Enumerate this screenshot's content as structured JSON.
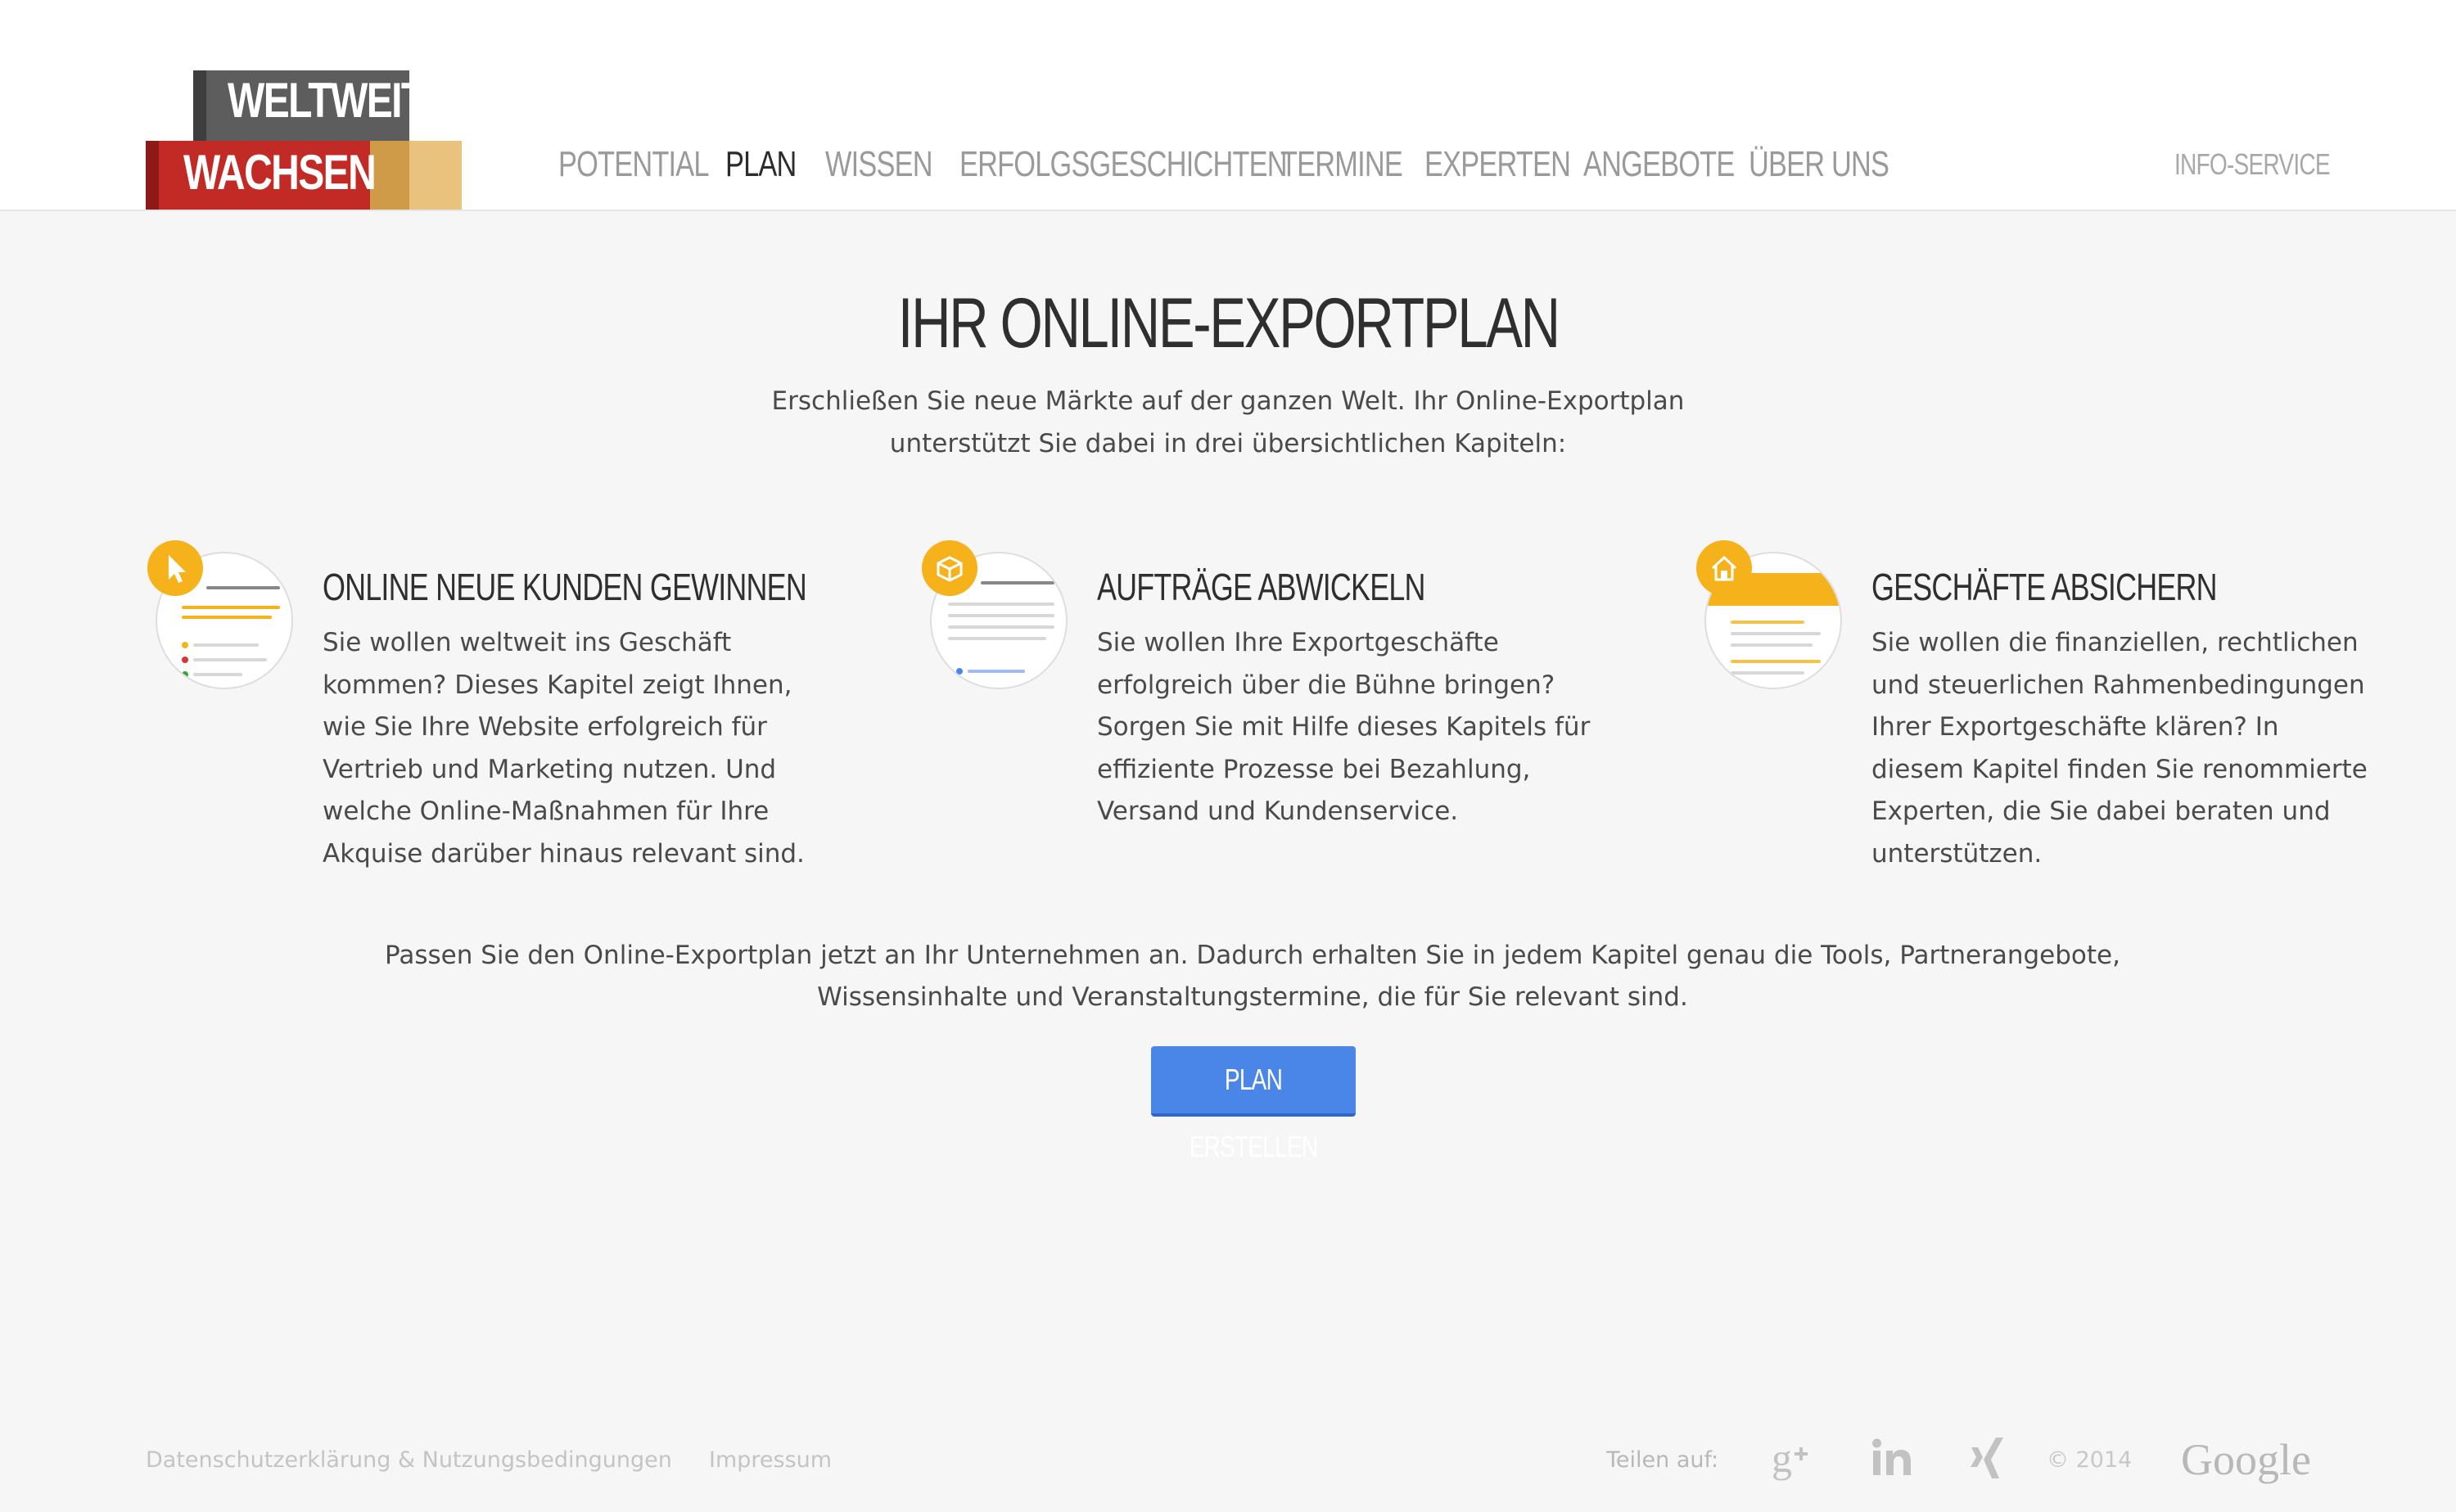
{
  "logo": {
    "line1": "WELTWEIT",
    "line2": "WACHSEN"
  },
  "nav": {
    "items": [
      {
        "label": "POTENTIAL"
      },
      {
        "label": "PLAN"
      },
      {
        "label": "WISSEN"
      },
      {
        "label": "ERFOLGSGESCHICHTEN"
      },
      {
        "label": "TERMINE"
      },
      {
        "label": "EXPERTEN"
      },
      {
        "label": "ANGEBOTE"
      },
      {
        "label": "ÜBER UNS"
      }
    ],
    "active": "PLAN",
    "info_service": "INFO-SERVICE"
  },
  "main": {
    "title": "IHR ONLINE-EXPORTPLAN",
    "intro_line1": "Erschließen Sie neue Märkte auf der ganzen Welt. Ihr Online-Exportplan",
    "intro_line2": "unterstützt Sie dabei in drei übersichtlichen Kapiteln:",
    "chapters": [
      {
        "title": "ONLINE NEUE KUNDEN GEWINNEN",
        "text": "Sie wollen weltweit ins Geschäft kommen? Dieses Kapitel zeigt Ihnen, wie Sie Ihre Website erfolgreich für Vertrieb und Marketing nutzen. Und welche Online-Maßnahmen für Ihre Akquise darüber hinaus relevant sind.",
        "icon": "cursor-icon"
      },
      {
        "title": "AUFTRÄGE ABWICKELN",
        "text": "Sie wollen Ihre Exportgeschäfte erfolgreich über die Bühne bringen? Sorgen Sie mit Hilfe dieses Kapitels für effiziente Prozesse bei Bezahlung, Versand und Kundenservice.",
        "icon": "package-icon"
      },
      {
        "title": "GESCHÄFTE ABSICHERN",
        "text": "Sie wollen die finanziellen, rechtlichen und steuerlichen Rahmenbedingungen Ihrer Exportgeschäfte klären? In diesem Kapitel finden Sie renommierte Experten, die Sie dabei beraten und unterstützen.",
        "icon": "house-shield-icon"
      }
    ],
    "passen_line1": "Passen Sie den Online-Exportplan jetzt an Ihr Unternehmen an. Dadurch erhalten Sie in jedem Kapitel genau die Tools, Partnerangebote,",
    "passen_line2": "Wissensinhalte und Veranstaltungstermine, die für Sie relevant sind.",
    "cta_label": "PLAN ERSTELLEN"
  },
  "footer": {
    "privacy": "Datenschutzerklärung & Nutzungsbedingungen",
    "imprint": "Impressum",
    "share_label": "Teilen auf:",
    "social": [
      "google-plus-icon",
      "linkedin-icon",
      "xing-icon"
    ],
    "copyright": "© 2014",
    "brand": "Google"
  },
  "colors": {
    "accent_yellow": "#f5b21a",
    "cta_blue": "#4a86e8",
    "logo_red": "#c12a25",
    "logo_gray": "#5d5d5d"
  }
}
